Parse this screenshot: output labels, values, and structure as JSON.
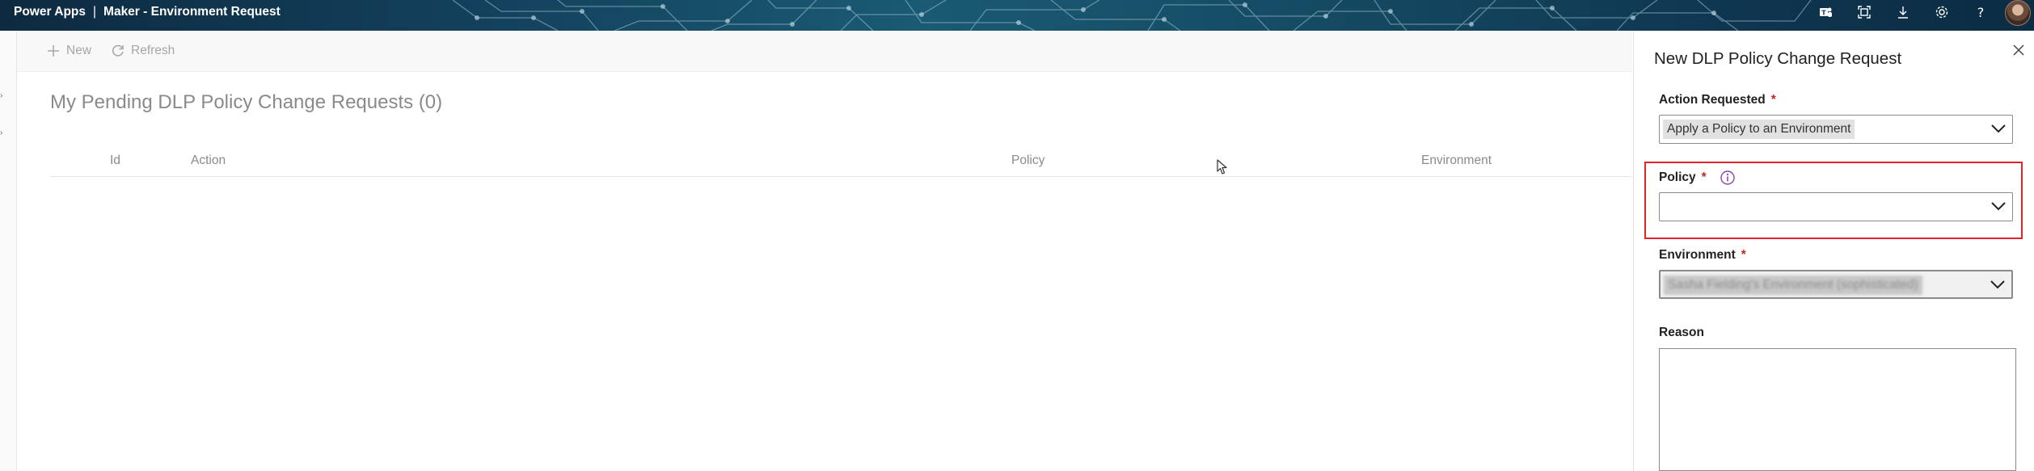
{
  "header": {
    "app_name": "Power Apps",
    "separator": "|",
    "page_name": "Maker - Environment Request",
    "icons": [
      "teams-icon",
      "focus-icon",
      "download-icon",
      "settings-icon",
      "help-icon",
      "avatar"
    ]
  },
  "command_bar": {
    "new_label": "New",
    "refresh_label": "Refresh"
  },
  "main": {
    "title": "My Pending DLP Policy Change Requests (0)",
    "columns": [
      "Id",
      "Action",
      "Policy",
      "Environment"
    ],
    "rows": []
  },
  "panel": {
    "title": "New DLP Policy Change Request",
    "action_label": "Action Requested",
    "action_value": "Apply a Policy to an Environment",
    "policy_label": "Policy",
    "policy_value": "",
    "environment_label": "Environment",
    "environment_value": "Sasha Fielding's Environment (sophisticated)",
    "reason_label": "Reason",
    "reason_value": "",
    "required_marker": "*"
  },
  "colors": {
    "accent_red": "#e0242c",
    "required": "#c62828",
    "info": "#8e44ad",
    "header_bg": "#13425e"
  }
}
